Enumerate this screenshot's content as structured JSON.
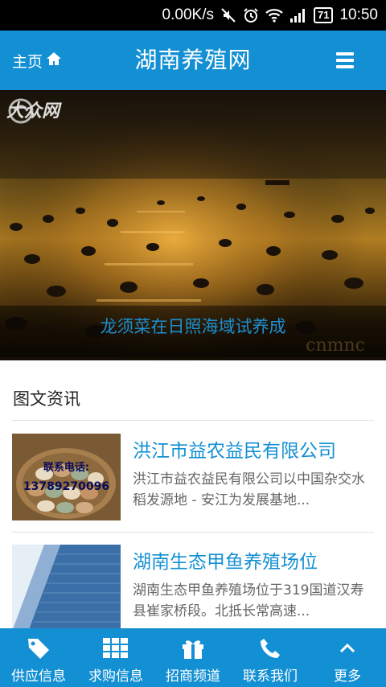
{
  "status_bar": {
    "speed": "0.00K/s",
    "battery": "71",
    "time": "10:50"
  },
  "header": {
    "home_label": "主页",
    "title": "湖南养殖网"
  },
  "banner": {
    "logo_text": "大众网",
    "caption": "龙须菜在日照海域试养成",
    "watermark": "cnmnc"
  },
  "section": {
    "title": "图文资讯"
  },
  "articles": [
    {
      "title": "洪江市益农益民有限公司",
      "desc": "洪江市益农益民有限公司以中国杂交水稻发源地 - 安江为发展基地..."
    },
    {
      "title": "湖南生态甲鱼养殖场位",
      "desc": "湖南生态甲鱼养殖场位于319国道汉寿县崔家桥段。北抵长常高速..."
    }
  ],
  "thumb_egg": {
    "label": "联系电话:",
    "phone": "13789270096"
  },
  "bottom_nav": [
    {
      "label": "供应信息",
      "icon": "tag-icon"
    },
    {
      "label": "求购信息",
      "icon": "grid-icon"
    },
    {
      "label": "招商频道",
      "icon": "gift-icon"
    },
    {
      "label": "联系我们",
      "icon": "phone-icon"
    },
    {
      "label": "更多",
      "icon": "chevron-up-icon"
    }
  ],
  "colors": {
    "brand": "#1390d4",
    "status_bar": "#000000"
  }
}
